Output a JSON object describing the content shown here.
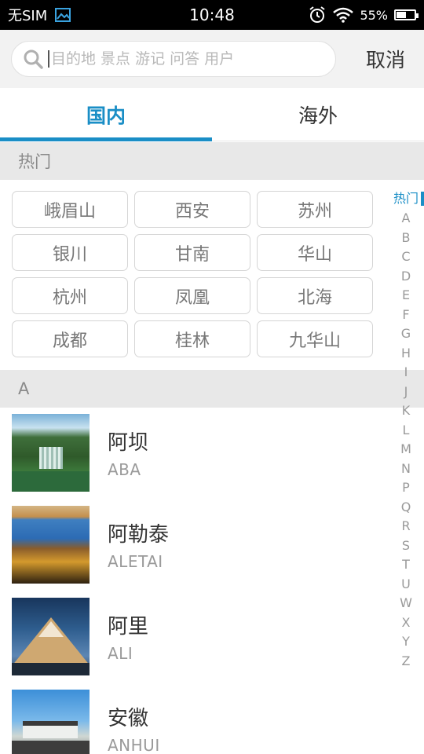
{
  "status_bar": {
    "carrier": "无SIM",
    "time": "10:48",
    "battery_percent": "55%",
    "battery_level": 0.55
  },
  "search": {
    "placeholder": "目的地 景点 游记 问答 用户",
    "cancel_label": "取消"
  },
  "tabs": [
    {
      "label": "国内",
      "active": true
    },
    {
      "label": "海外",
      "active": false
    }
  ],
  "hot_section": {
    "header": "热门",
    "cities": [
      "峨眉山",
      "西安",
      "苏州",
      "银川",
      "甘南",
      "华山",
      "杭州",
      "凤凰",
      "北海",
      "成都",
      "桂林",
      "九华山"
    ]
  },
  "section_a": {
    "header": "A",
    "cities": [
      {
        "name": "阿坝",
        "pinyin": "ABA",
        "thumb": "waterfall-forest"
      },
      {
        "name": "阿勒泰",
        "pinyin": "ALETAI",
        "thumb": "lake-grassland"
      },
      {
        "name": "阿里",
        "pinyin": "ALI",
        "thumb": "snow-mountain"
      },
      {
        "name": "安徽",
        "pinyin": "ANHUI",
        "thumb": "village-river"
      }
    ]
  },
  "index_bar": [
    "热门",
    "A",
    "B",
    "C",
    "D",
    "E",
    "F",
    "G",
    "H",
    "I",
    "J",
    "K",
    "L",
    "M",
    "N",
    "P",
    "Q",
    "R",
    "S",
    "T",
    "U",
    "W",
    "X",
    "Y",
    "Z"
  ],
  "colors": {
    "accent": "#1a8ec6",
    "section_bg": "#e8e8e8",
    "header_bg": "#f2f2f2"
  },
  "icons": {
    "search": "search-icon",
    "gallery": "gallery-icon",
    "alarm": "alarm-icon",
    "wifi": "wifi-icon",
    "battery": "battery-icon"
  }
}
